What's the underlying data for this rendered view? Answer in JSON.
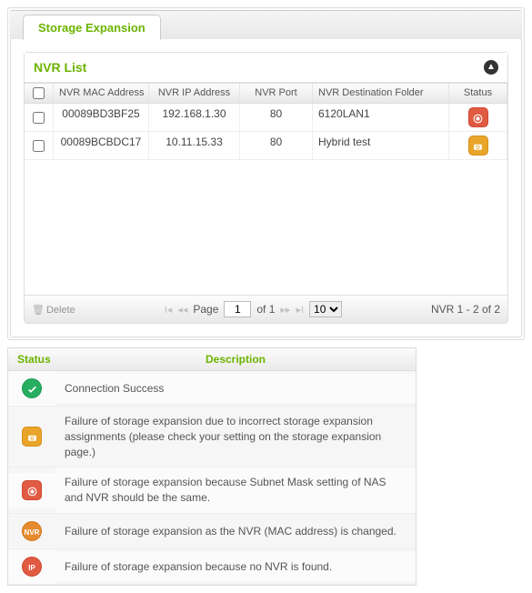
{
  "tab": {
    "label": "Storage Expansion"
  },
  "section": {
    "title": "NVR List"
  },
  "columns": {
    "mac": "NVR MAC Address",
    "ip": "NVR IP Address",
    "port": "NVR Port",
    "folder": "NVR Destination Folder",
    "status": "Status"
  },
  "rows": [
    {
      "mac": "00089BD3BF25",
      "ip": "192.168.1.30",
      "port": "80",
      "folder": "6120LAN1",
      "status_class": "badge-red",
      "status_icon": "◎"
    },
    {
      "mac": "00089BCBDC17",
      "ip": "10.11.15.33",
      "port": "80",
      "folder": "Hybrid test",
      "status_class": "badge-yellow",
      "status_icon": "📷"
    }
  ],
  "toolbar": {
    "delete": "Delete",
    "page_label": "Page",
    "page_value": "1",
    "page_total": "of 1",
    "page_size": "10",
    "range": "NVR 1 - 2 of 2"
  },
  "legend": {
    "col_status": "Status",
    "col_desc": "Description",
    "items": [
      {
        "badge_class": "badge-green badge-circle",
        "glyph": "✓",
        "desc": "Connection Success"
      },
      {
        "badge_class": "badge-yellow",
        "glyph": "📷",
        "desc": "Failure of storage expansion due to incorrect storage expansion assignments (please check your setting on the storage expansion page.)"
      },
      {
        "badge_class": "badge-red",
        "glyph": "◎",
        "desc": "Failure of storage expansion because Subnet Mask setting of NAS and NVR should be the same."
      },
      {
        "badge_class": "badge-orange badge-circle",
        "glyph": "NVR",
        "desc": "Failure of storage expansion as the NVR (MAC address) is changed."
      },
      {
        "badge_class": "badge-red badge-circle",
        "glyph": "IP",
        "desc": "Failure of storage expansion because no NVR is found."
      }
    ]
  }
}
